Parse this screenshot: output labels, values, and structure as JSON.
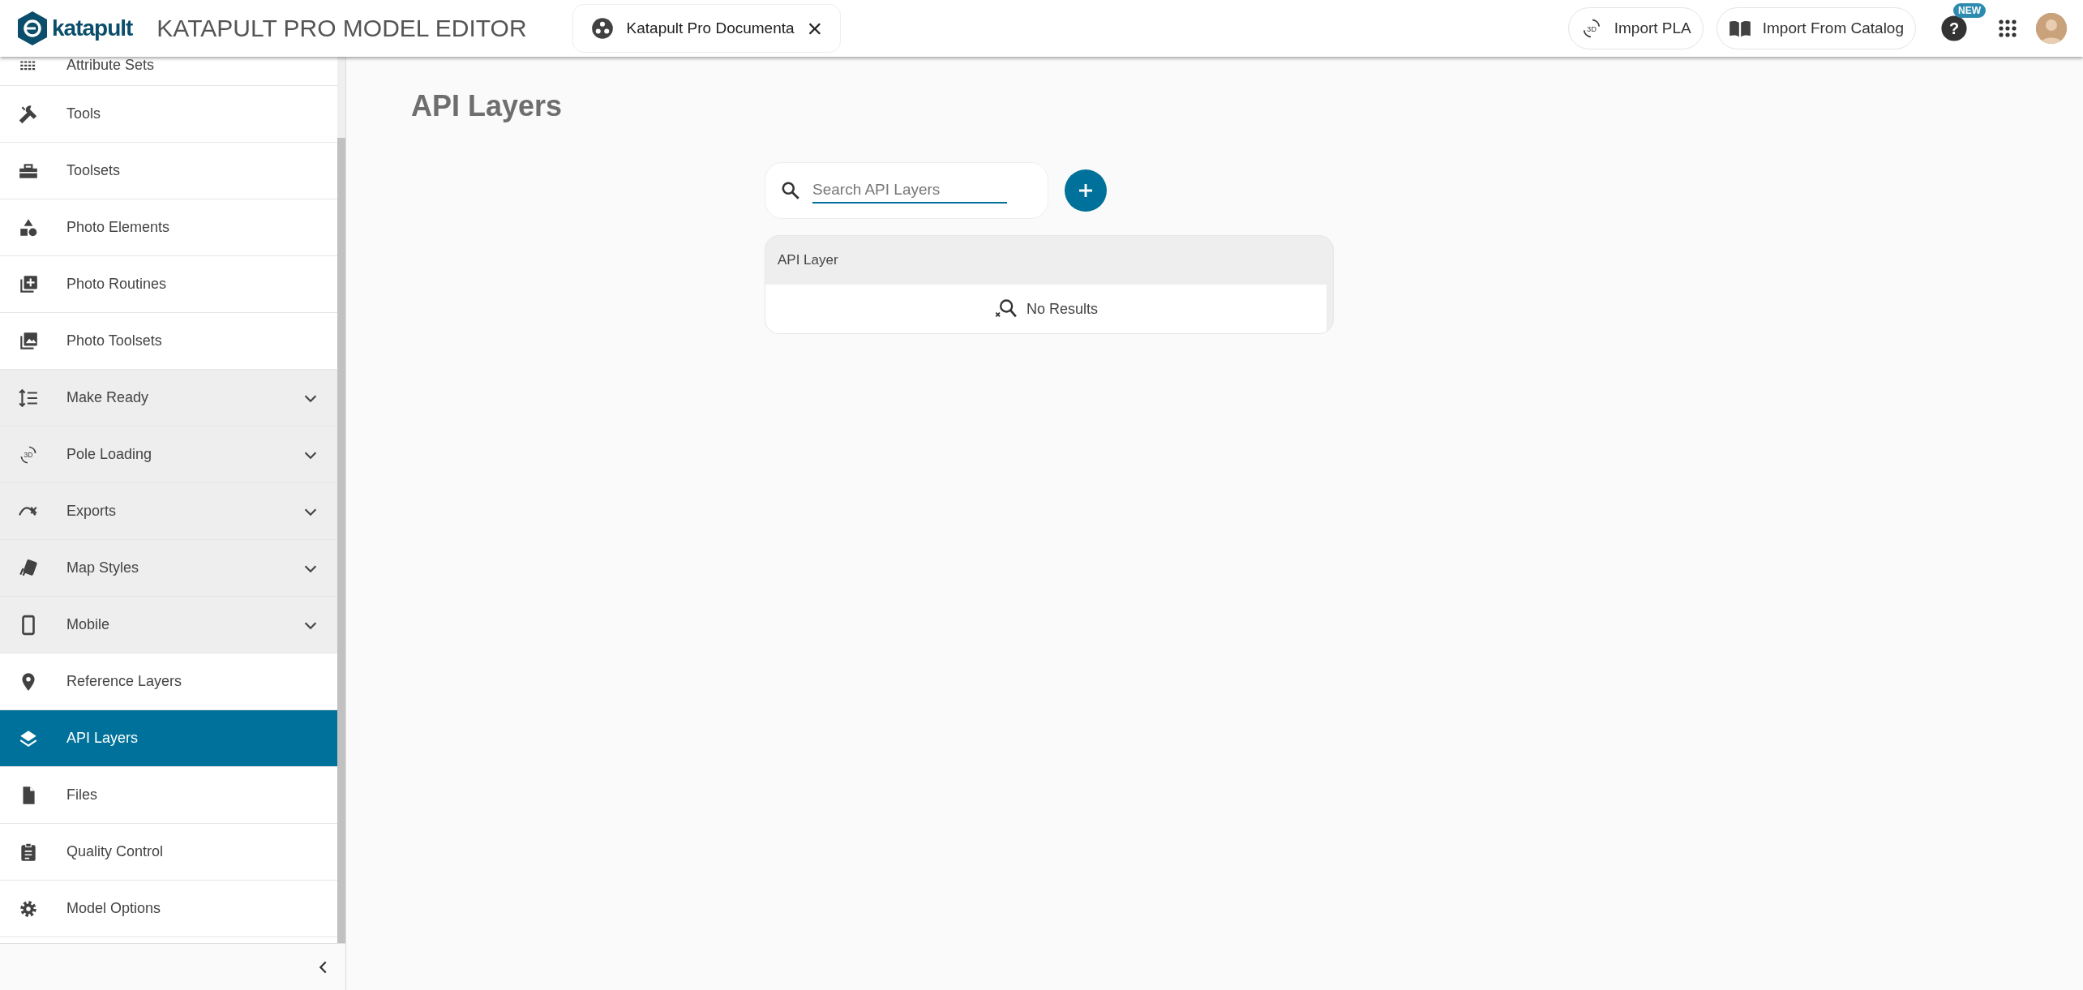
{
  "header": {
    "logo_text": "katapult",
    "title": "KATAPULT PRO MODEL EDITOR",
    "document_chip": {
      "label": "Katapult Pro Documenta",
      "close": "×"
    },
    "actions": [
      {
        "label": "Import PLA",
        "icon_text": "3D"
      },
      {
        "label": "Import From Catalog"
      }
    ],
    "help_text": "?",
    "help_badge": "NEW"
  },
  "sidebar": {
    "items": [
      {
        "label": "Attribute Sets",
        "kind": "link",
        "selected": false
      },
      {
        "label": "Tools",
        "kind": "link",
        "selected": false
      },
      {
        "label": "Toolsets",
        "kind": "link",
        "selected": false
      },
      {
        "label": "Photo Elements",
        "kind": "link",
        "selected": false
      },
      {
        "label": "Photo Routines",
        "kind": "link",
        "selected": false
      },
      {
        "label": "Photo Toolsets",
        "kind": "link",
        "selected": false
      },
      {
        "label": "Make Ready",
        "kind": "group",
        "expanded": false,
        "selected": false
      },
      {
        "label": "Pole Loading",
        "kind": "group",
        "expanded": false,
        "selected": false,
        "icon_text": "3D"
      },
      {
        "label": "Exports",
        "kind": "group",
        "expanded": false,
        "selected": false
      },
      {
        "label": "Map Styles",
        "kind": "group",
        "expanded": false,
        "selected": false
      },
      {
        "label": "Mobile",
        "kind": "group",
        "expanded": false,
        "selected": false
      },
      {
        "label": "Reference Layers",
        "kind": "link",
        "selected": false
      },
      {
        "label": "API Layers",
        "kind": "link",
        "selected": true
      },
      {
        "label": "Files",
        "kind": "link",
        "selected": false
      },
      {
        "label": "Quality Control",
        "kind": "link",
        "selected": false
      },
      {
        "label": "Model Options",
        "kind": "link",
        "selected": false
      }
    ]
  },
  "main": {
    "title": "API Layers",
    "search": {
      "placeholder": "Search API Layers"
    },
    "table": {
      "columns": [
        "API Layer"
      ],
      "empty_text": "No Results"
    }
  }
}
